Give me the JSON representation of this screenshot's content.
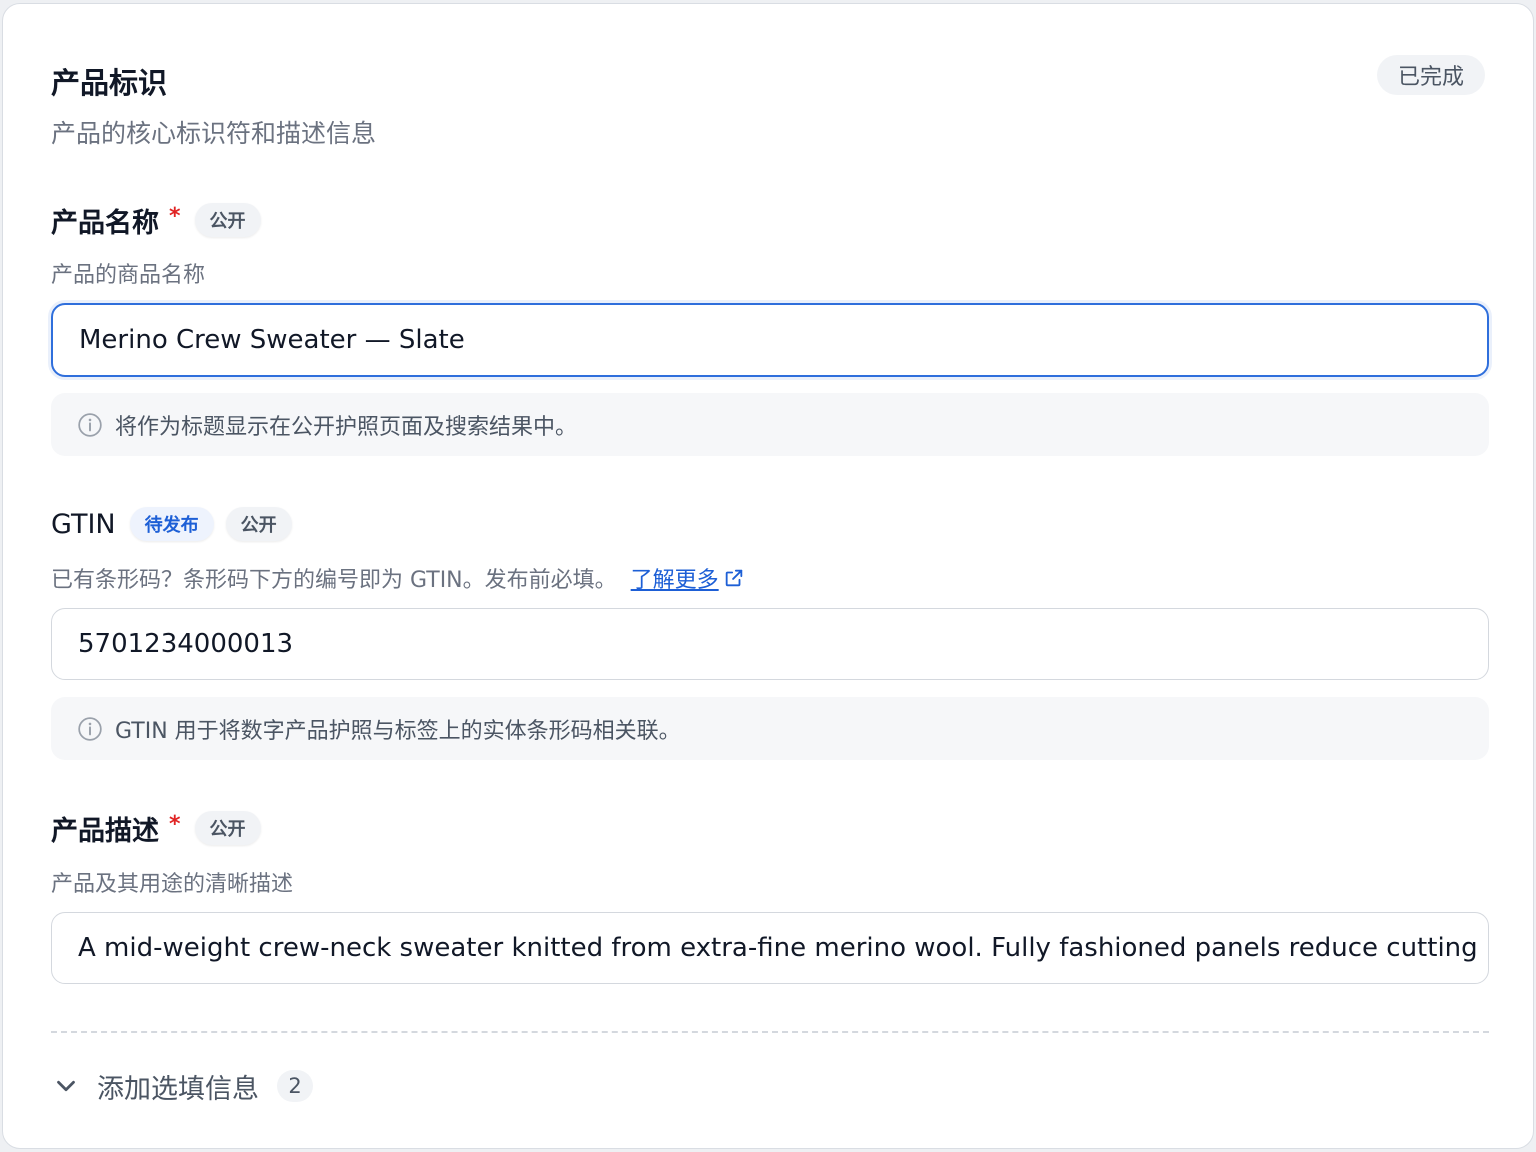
{
  "section": {
    "title": "产品标识",
    "subtitle": "产品的核心标识符和描述信息",
    "status": "已完成"
  },
  "fields": [
    {
      "label": "产品名称",
      "required": "*",
      "badges": [
        "公开"
      ],
      "description": "产品的商品名称",
      "value": "Merino Crew Sweater — Slate",
      "hint": "将作为标题显示在公开护照页面及搜索结果中。"
    },
    {
      "label": "GTIN",
      "badges": [
        "待发布",
        "公开"
      ],
      "description": "已有条形码？条形码下方的编号即为 GTIN。发布前必填。",
      "link": "了解更多",
      "value": "5701234000013",
      "hint": "GTIN 用于将数字产品护照与标签上的实体条形码相关联。"
    },
    {
      "label": "产品描述",
      "required": "*",
      "badges": [
        "公开"
      ],
      "description": "产品及其用途的清晰描述",
      "value": "A mid-weight crew-neck sweater knitted from extra-fine merino wool. Fully fashioned panels reduce cutting"
    }
  ],
  "optional": {
    "label": "添加选填信息",
    "count": "2"
  },
  "icons": {
    "hint": "info-circle-icon",
    "link": "external-link-icon",
    "optional": "chevron-down-icon"
  },
  "colors": {
    "accent": "#2f6fdc",
    "required": "#e02424",
    "link": "#1d5fd6"
  }
}
